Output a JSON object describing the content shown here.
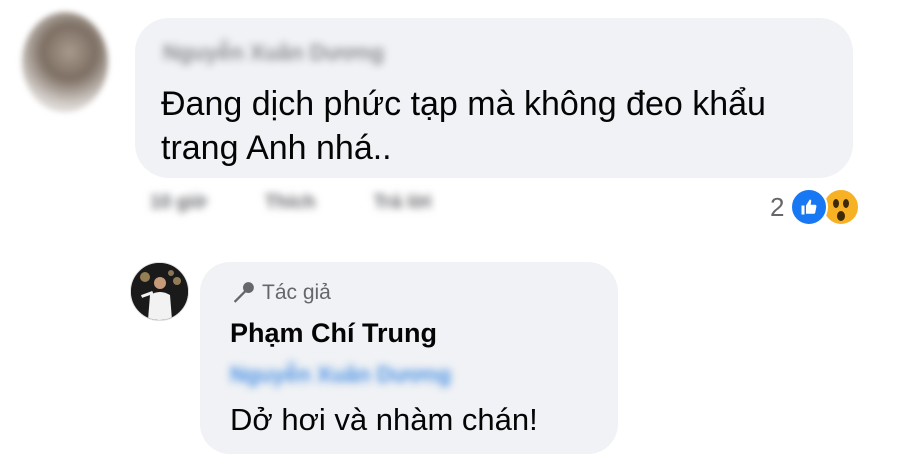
{
  "comment1": {
    "author_name": "Nguyễn Xuân Dương",
    "text": "Đang dịch phức tạp mà không đeo khẩu trang Anh nhá..",
    "actions": [
      "10 giờ",
      "Thích",
      "Trả lời"
    ],
    "reactions": {
      "count": "2",
      "icons": [
        "like-icon",
        "wow-icon"
      ]
    }
  },
  "reply": {
    "badge_label": "Tác giả",
    "author_name": "Phạm Chí Trung",
    "mention": "Nguyễn Xuân Dương",
    "text": "Dở hơi và nhàm chán!"
  },
  "colors": {
    "bubble": "#f0f2f5",
    "text": "#050505",
    "muted": "#65676b",
    "link": "#1877f2",
    "wow": "#f7b125"
  }
}
